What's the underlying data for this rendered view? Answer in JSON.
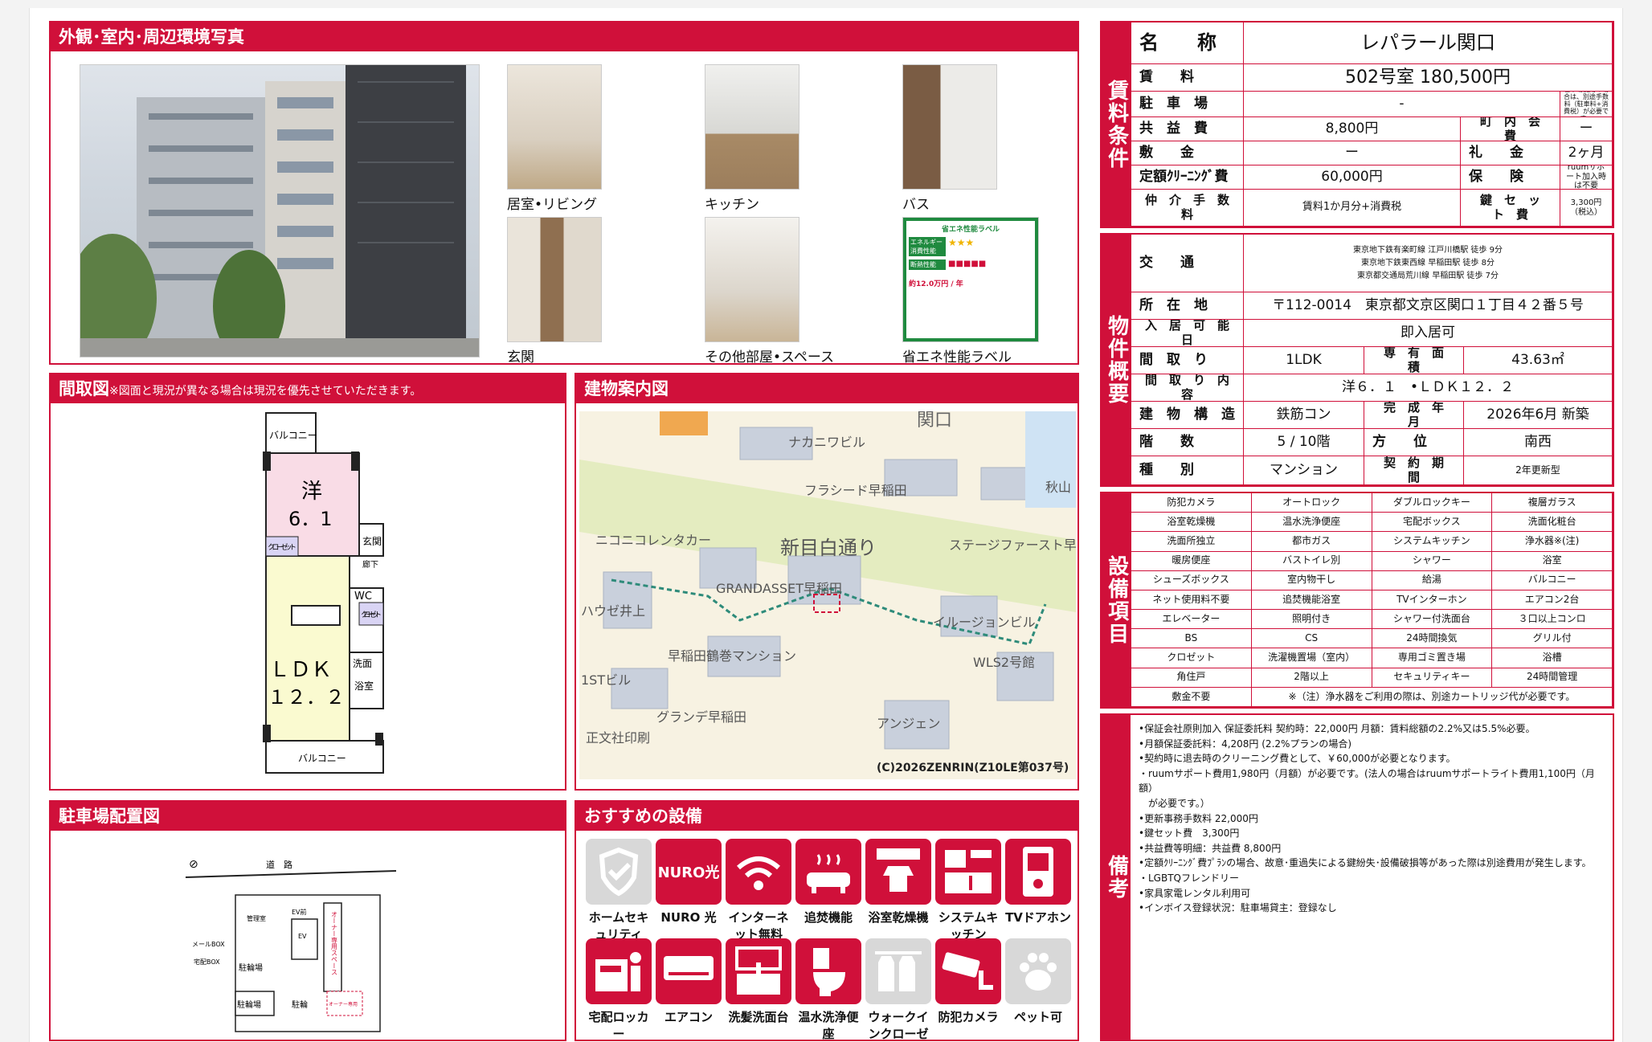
{
  "sections": {
    "photos": "外観･室内･周辺環境写真",
    "floorplan": "間取図",
    "floorplan_note": "※図面と現況が異なる場合は現況を優先させていただきます。",
    "map": "建物案内図",
    "parking": "駐車場配置図",
    "recommend": "おすすめの設備"
  },
  "photo_labels": [
    "居室•リビング",
    "キッチン",
    "バス",
    "玄関",
    "その他部屋•スペース",
    "省エネ性能ラベル"
  ],
  "energy_label": {
    "title": "省エネ性能ラベル",
    "r1": "エネルギー消費性能",
    "r2": "断熱性能",
    "cost": "約12.0万円 / 年"
  },
  "floorplan": {
    "balcony": "バルコニー",
    "western": "洋",
    "western_size": "6．1",
    "closet": "クローゼット",
    "entrance": "玄関",
    "hall": "廊下",
    "wc": "WC",
    "closet2": "クローゼット",
    "ldk": "ＬＤＫ",
    "ldk_size": "１２．２",
    "wash": "洗面",
    "bath": "浴室",
    "balcony2": "バルコニー"
  },
  "map": {
    "street": "新目白通り",
    "p1": "ナカニワビル",
    "p2": "フラシード早稲田",
    "p3": "ニコニコレンタカー",
    "p4": "GRANDASSET早稲田",
    "p5": "ステージファースト早",
    "p6": "イルージョンビル",
    "p7": "早稲田鶴巻マンション",
    "p8": "WLS2号館",
    "p9": "グランデ早稲田",
    "p10": "アンジェン",
    "p11": "1STビル",
    "p12": "ハウゼ井上",
    "p13": "正文社印刷",
    "p14": "秋山",
    "p15": "関口",
    "copyright": "(C)2026ZENRIN(Z10LE第037号)"
  },
  "parking": {
    "road": "道　路",
    "mailbox": "メールBOX",
    "deliverybox": "宅配BOX",
    "bike": "駐輪場",
    "bike2": "駐輪場",
    "bike3": "駐輪",
    "ev": "EV",
    "ev2": "EV前",
    "owner": "オーナー専用スペース",
    "owner2": "オーナー専用",
    "manager": "管理室"
  },
  "rent": {
    "label": "賃料条件",
    "name_h": "名　　称",
    "name": "レパラール関口",
    "rent_h": "賃　　料",
    "rent": "502号室 180,500円",
    "park_h": "駐　車　場",
    "park": "-",
    "park_note": "駐車場使用の場合は、別途手数料（駐車料+消費税）が必要です。",
    "common_h": "共　益　費",
    "common": "8,800円",
    "town_h": "町　内　会　費",
    "town": "ー",
    "deposit_h": "敷　　金",
    "deposit": "ー",
    "key_h": "礼　　金",
    "key": "2ヶ月",
    "clean_h": "定額ｸﾘｰﾆﾝｸﾞ費",
    "clean": "60,000円",
    "ins_h": "保　　険",
    "ins": "ruumサポート加入時は不要",
    "broker_h": "仲　介　手　数　料",
    "broker": "賃料1か月分+消費税",
    "lock_h": "鍵　セ　ッ　ト　費",
    "lock": "3,300円（税込）"
  },
  "property": {
    "label": "物件概要",
    "access_h": "交　　通",
    "access": [
      "東京地下鉄有楽町線 江戸川橋駅 徒歩 9分",
      "東京地下鉄東西線 早稲田駅 徒歩 8分",
      "東京都交通局荒川線 早稲田駅 徒歩 7分"
    ],
    "addr_h": "所　在　地",
    "addr": "〒112-0014　東京都文京区関口１丁目４２番５号",
    "movein_h": "入　居　可　能　日",
    "movein": "即入居可",
    "layout_h": "間　取　り",
    "layout": "1LDK",
    "area_h": "専　有　面　積",
    "area": "43.63㎡",
    "detail_h": "間　取　り　内　容",
    "detail": "洋６．１　•ＬＤＫ１２．２",
    "struct_h": "建　物　構　造",
    "struct": "鉄筋コン",
    "built_h": "完　成　年　月",
    "built": "2026年6月 新築",
    "floor_h": "階　　数",
    "floor": "5 / 10階",
    "dir_h": "方　　位",
    "dir": "南西",
    "type_h": "種　　別",
    "type": "マンション",
    "contract_h": "契　約　期　間",
    "contract": "2年更新型"
  },
  "equipment": {
    "label": "設備項目",
    "items": [
      "防犯カメラ",
      "オートロック",
      "ダブルロックキー",
      "複層ガラス",
      "浴室乾燥機",
      "温水洗浄便座",
      "宅配ボックス",
      "洗面化粧台",
      "洗面所独立",
      "都市ガス",
      "システムキッチン",
      "浄水器※(注)",
      "暖房便座",
      "バストイレ別",
      "シャワー",
      "浴室",
      "シューズボックス",
      "室内物干し",
      "給湯",
      "バルコニー",
      "ネット使用料不要",
      "追焚機能浴室",
      "TVインターホン",
      "エアコン2台",
      "エレベーター",
      "照明付き",
      "シャワー付洗面台",
      "３口以上コンロ",
      "BS",
      "CS",
      "24時間換気",
      "グリル付",
      "クロゼット",
      "洗濯機置場（室内）",
      "専用ゴミ置き場",
      "浴槽",
      "角住戸",
      "2階以上",
      "セキュリティキー",
      "24時間管理",
      "敷金不要"
    ],
    "note": "※（注）浄水器をご利用の際は、別途カートリッジ代が必要です。"
  },
  "remarks": {
    "label": "備考",
    "lines": [
      "•保証会社原則加入 保証委託料 契約時：22,000円 月額：賃料総額の2.2%又は5.5%必要。",
      "•月額保証委託料：4,208円 (2.2%プランの場合)",
      "•契約時に退去時のクリーニング費として、￥60,000が必要となります。",
      "・ruumサポート費用1,980円（月額）が必要です。(法人の場合はruumサポートライト費用1,100円（月額）\n　が必要です。）",
      "•更新事務手数料 22,000円",
      "•鍵セット費　3,300円",
      "•共益費等明細：共益費 8,800円",
      "•定額ｸﾘｰﾆﾝｸﾞ費ﾌﾟﾗﾝの場合、故意･重過失による鍵紛失･設備破損等があった際は別途費用が発生します。",
      "・LGBTQフレンドリー",
      "•家具家電レンタル利用可",
      "•インボイス登録状況：駐車場貸主：登録なし"
    ]
  },
  "facilities": [
    {
      "label": "ホームセキュリティ",
      "icon": "shield-icon",
      "grey": true
    },
    {
      "label": "NURO 光",
      "icon": "nuro-logo-icon",
      "text": "NURO光"
    },
    {
      "label": "インターネット無料",
      "icon": "wifi-icon"
    },
    {
      "label": "追焚機能",
      "icon": "bathtub-icon"
    },
    {
      "label": "浴室乾燥機",
      "icon": "bath-dryer-icon"
    },
    {
      "label": "システムキッチン",
      "icon": "kitchen-icon"
    },
    {
      "label": "TVドアホン",
      "icon": "intercom-icon"
    },
    {
      "label": "宅配ロッカー",
      "icon": "delivery-locker-icon"
    },
    {
      "label": "エアコン",
      "icon": "air-conditioner-icon"
    },
    {
      "label": "洗髪洗面台",
      "icon": "washbasin-icon"
    },
    {
      "label": "温水洗浄便座",
      "icon": "toilet-icon"
    },
    {
      "label": "ウォークインクローゼット",
      "icon": "walk-in-closet-icon",
      "grey": true
    },
    {
      "label": "防犯カメラ",
      "icon": "security-camera-icon"
    },
    {
      "label": "ペット可",
      "icon": "paw-icon",
      "grey": true
    }
  ]
}
